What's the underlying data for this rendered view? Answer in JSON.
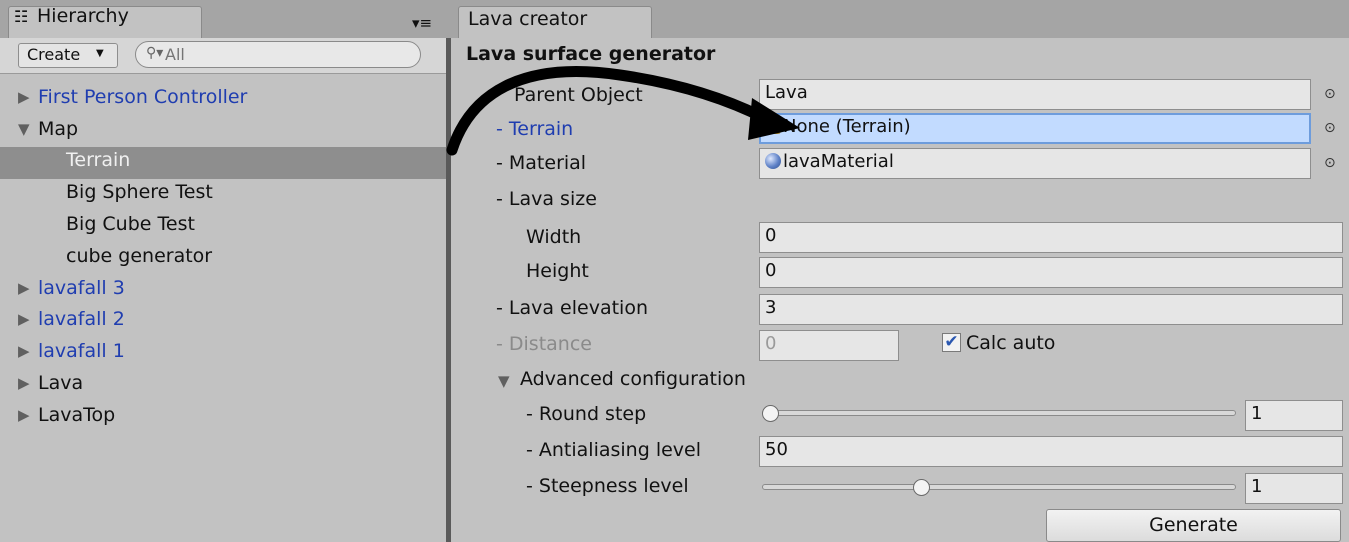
{
  "hierarchy": {
    "tab_label": "Hierarchy",
    "tab_icon": "list-icon",
    "menu_icon": "panel-menu-icon",
    "create_label": "Create",
    "search_placeholder": "All",
    "items": [
      {
        "label": "First Person Controller",
        "expand": "collapsed",
        "prefab": true,
        "indent": 0
      },
      {
        "label": "Map",
        "expand": "expanded",
        "prefab": false,
        "indent": 0
      },
      {
        "label": "Terrain",
        "expand": "none",
        "prefab": false,
        "indent": 1,
        "selected": true
      },
      {
        "label": "Big Sphere Test",
        "expand": "none",
        "prefab": false,
        "indent": 1
      },
      {
        "label": "Big Cube Test",
        "expand": "none",
        "prefab": false,
        "indent": 1
      },
      {
        "label": "cube generator",
        "expand": "none",
        "prefab": false,
        "indent": 1
      },
      {
        "label": "lavafall 3",
        "expand": "collapsed",
        "prefab": true,
        "indent": 0
      },
      {
        "label": "lavafall 2",
        "expand": "collapsed",
        "prefab": true,
        "indent": 0
      },
      {
        "label": "lavafall 1",
        "expand": "collapsed",
        "prefab": true,
        "indent": 0
      },
      {
        "label": "Lava",
        "expand": "collapsed",
        "prefab": false,
        "indent": 0
      },
      {
        "label": "LavaTop",
        "expand": "collapsed",
        "prefab": false,
        "indent": 0
      }
    ]
  },
  "creator": {
    "tab_label": "Lava creator",
    "section_title": "Lava surface generator",
    "parent_object": {
      "label": "Parent Object",
      "value": "Lava"
    },
    "terrain": {
      "label": "- Terrain",
      "value": "None (Terrain)",
      "icon": "terrain-icon"
    },
    "material": {
      "label": "- Material",
      "value": "lavaMaterial",
      "icon": "material-sphere-icon"
    },
    "lava_size": {
      "label": "- Lava size"
    },
    "width": {
      "label": "Width",
      "value": "0"
    },
    "height": {
      "label": "Height",
      "value": "0"
    },
    "elevation": {
      "label": "- Lava elevation",
      "value": "3"
    },
    "distance": {
      "label": "- Distance",
      "value": "0"
    },
    "calc_auto": {
      "label": "Calc auto",
      "checked": true
    },
    "advanced": {
      "label": "Advanced configuration",
      "expanded": true
    },
    "round_step": {
      "label": "- Round step",
      "value": "1",
      "slider_fraction": 0.0
    },
    "antialiasing": {
      "label": "- Antialiasing level",
      "value": "50"
    },
    "steepness": {
      "label": "- Steepness level",
      "value": "1",
      "slider_fraction": 0.33
    },
    "generate_label": "Generate",
    "picker_icon": "object-picker-icon"
  },
  "colors": {
    "prefab_blue": "#1f3db0",
    "selection_gray": "#8e8e8e",
    "highlight_field": "#c2dbff"
  }
}
